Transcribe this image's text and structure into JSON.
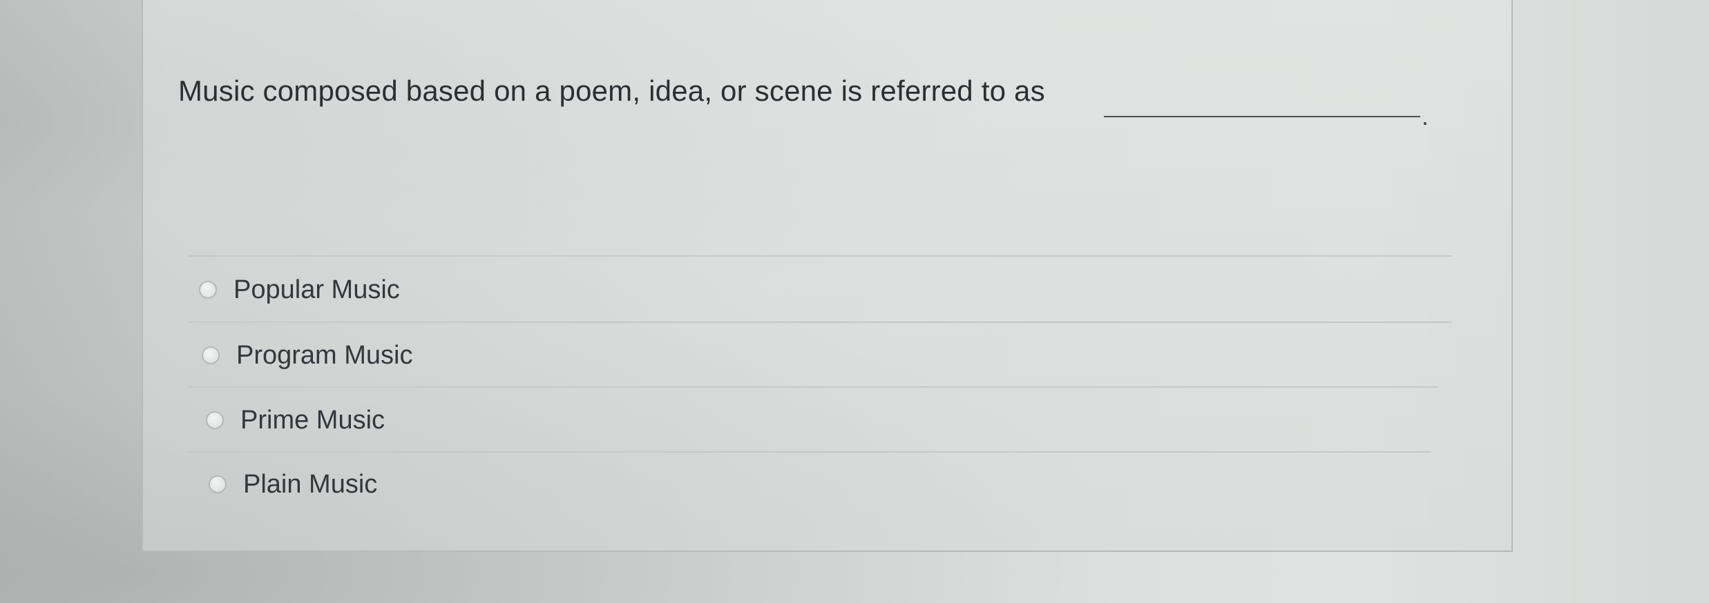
{
  "question": {
    "text": "Music composed based on a poem, idea, or scene is referred to as",
    "blank_suffix": "."
  },
  "options": [
    {
      "label": "Popular Music",
      "selected": false
    },
    {
      "label": "Program Music",
      "selected": false
    },
    {
      "label": "Prime Music",
      "selected": false
    },
    {
      "label": "Plain Music",
      "selected": false
    }
  ]
}
